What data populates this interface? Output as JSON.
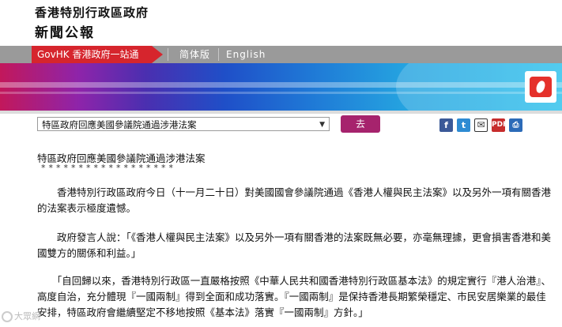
{
  "header": {
    "title_line1": "香港特別行政區政府",
    "title_line2": "新聞公報"
  },
  "nav": {
    "govhk": "GovHK 香港政府一站通",
    "simplified": "简体版",
    "english": "English"
  },
  "selector": {
    "selected": "特區政府回應美國參議院通過涉港法案",
    "go_label": "去"
  },
  "share": {
    "facebook": "f",
    "twitter": "t",
    "email": "✉",
    "pdf": "PDF",
    "print": "⎙"
  },
  "article": {
    "title": "特區政府回應美國參議院通過涉港法案",
    "stars": "******************",
    "p1": "　　香港特別行政區政府今日（十一月二十日）對美國國會參議院通過《香港人權與民主法案》以及另外一項有關香港的法案表示極度遺憾。",
    "p2": "　　政府發言人說：「《香港人權與民主法案》以及另外一項有關香港的法案既無必要，亦毫無理據，更會損害香港和美國雙方的關係和利益。」",
    "p3": "　　「自回歸以來，香港特別行政區一直嚴格按照《中華人民共和國香港特別行政區基本法》的規定實行『港人治港』、高度自治，充分體現『一國兩制』得到全面和成功落實。『一國兩制』是保持香港長期繁榮穩定、市民安居樂業的最佳安排，特區政府會繼續堅定不移地按照《基本法》落實『一國兩制』方針。」"
  },
  "watermark": "大眾網"
}
